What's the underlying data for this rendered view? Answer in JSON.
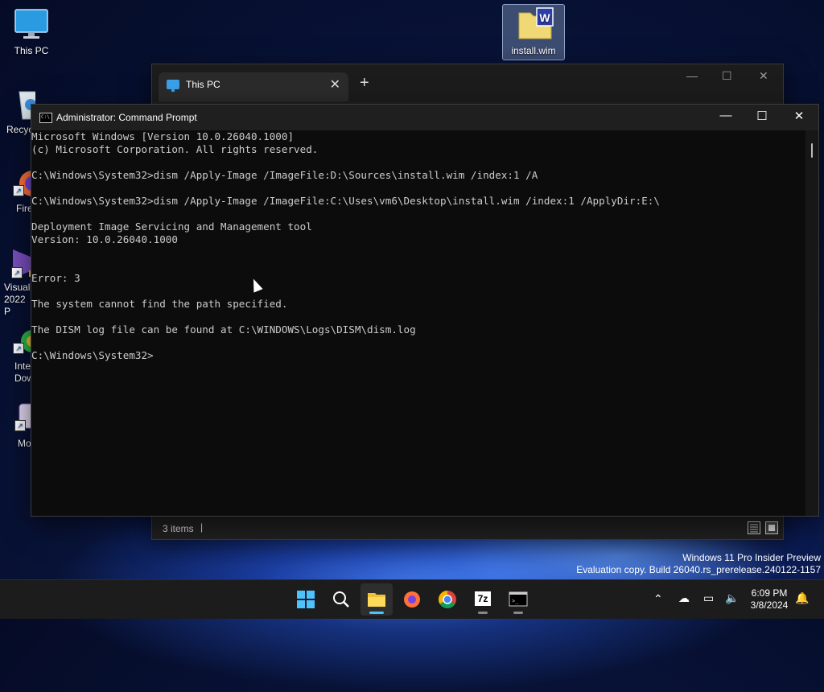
{
  "desktop": {
    "icons": [
      {
        "label": "This PC"
      },
      {
        "label": "Recyc"
      },
      {
        "label": "Fire"
      },
      {
        "label": "Visual 2022 P"
      },
      {
        "label": "Inte Dow"
      },
      {
        "label": "Mo"
      },
      {
        "label": "install.wim"
      }
    ]
  },
  "explorer": {
    "tab_label": "This PC",
    "new_tab": "+",
    "status_count": "3 items",
    "status_sep": "|"
  },
  "cmd": {
    "title": "Administrator: Command Prompt",
    "lines": [
      "Microsoft Windows [Version 10.0.26040.1000]",
      "(c) Microsoft Corporation. All rights reserved.",
      "",
      "C:\\Windows\\System32>dism /Apply-Image /ImageFile:D:\\Sources\\install.wim /index:1 /A",
      "",
      "C:\\Windows\\System32>dism /Apply-Image /ImageFile:C:\\Uses\\vm6\\Desktop\\install.wim /index:1 /ApplyDir:E:\\",
      "",
      "Deployment Image Servicing and Management tool",
      "Version: 10.0.26040.1000",
      "",
      "",
      "Error: 3",
      "",
      "The system cannot find the path specified.",
      "",
      "The DISM log file can be found at C:\\WINDOWS\\Logs\\DISM\\dism.log",
      "",
      "C:\\Windows\\System32>"
    ]
  },
  "watermark": {
    "line1": "Windows 11 Pro Insider Preview",
    "line2": "Evaluation copy. Build 26040.rs_prerelease.240122-1157"
  },
  "taskbar": {
    "apps": [
      {
        "name": "start"
      },
      {
        "name": "search"
      },
      {
        "name": "file-explorer"
      },
      {
        "name": "firefox"
      },
      {
        "name": "chrome"
      },
      {
        "name": "7-zip",
        "label": "7z"
      },
      {
        "name": "command-prompt"
      }
    ],
    "clock_time": "6:09 PM",
    "clock_date": "3/8/2024"
  },
  "colors": {
    "accent": "#4cc2ff",
    "console_text": "#cccccc",
    "console_bg": "#0c0c0c"
  }
}
